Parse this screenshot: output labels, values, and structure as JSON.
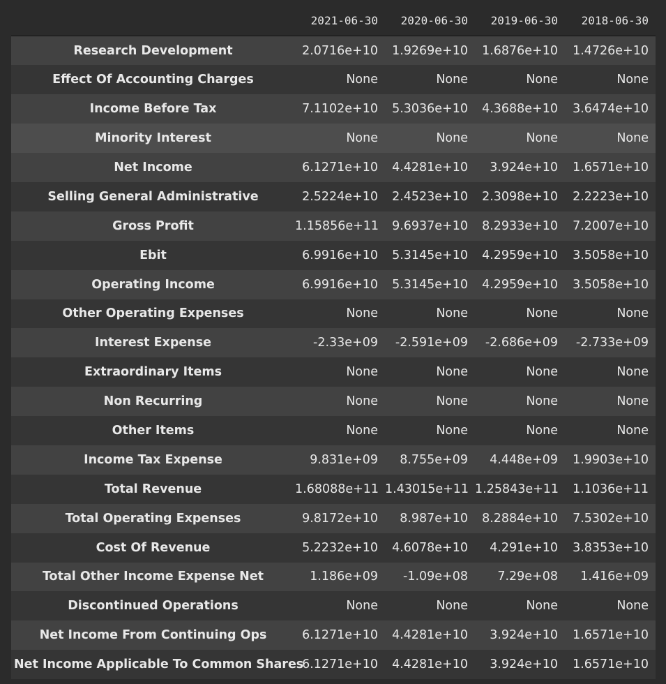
{
  "table": {
    "columns": [
      "2021-06-30",
      "2020-06-30",
      "2019-06-30",
      "2018-06-30"
    ],
    "rows": [
      {
        "label": "Research Development",
        "values": [
          "2.0716e+10",
          "1.9269e+10",
          "1.6876e+10",
          "1.4726e+10"
        ]
      },
      {
        "label": "Effect Of Accounting Charges",
        "values": [
          "None",
          "None",
          "None",
          "None"
        ]
      },
      {
        "label": "Income Before Tax",
        "values": [
          "7.1102e+10",
          "5.3036e+10",
          "4.3688e+10",
          "3.6474e+10"
        ]
      },
      {
        "label": "Minority Interest",
        "values": [
          "None",
          "None",
          "None",
          "None"
        ]
      },
      {
        "label": "Net Income",
        "values": [
          "6.1271e+10",
          "4.4281e+10",
          "3.924e+10",
          "1.6571e+10"
        ]
      },
      {
        "label": "Selling General Administrative",
        "values": [
          "2.5224e+10",
          "2.4523e+10",
          "2.3098e+10",
          "2.2223e+10"
        ]
      },
      {
        "label": "Gross Profit",
        "values": [
          "1.15856e+11",
          "9.6937e+10",
          "8.2933e+10",
          "7.2007e+10"
        ]
      },
      {
        "label": "Ebit",
        "values": [
          "6.9916e+10",
          "5.3145e+10",
          "4.2959e+10",
          "3.5058e+10"
        ]
      },
      {
        "label": "Operating Income",
        "values": [
          "6.9916e+10",
          "5.3145e+10",
          "4.2959e+10",
          "3.5058e+10"
        ]
      },
      {
        "label": "Other Operating Expenses",
        "values": [
          "None",
          "None",
          "None",
          "None"
        ]
      },
      {
        "label": "Interest Expense",
        "values": [
          "-2.33e+09",
          "-2.591e+09",
          "-2.686e+09",
          "-2.733e+09"
        ]
      },
      {
        "label": "Extraordinary Items",
        "values": [
          "None",
          "None",
          "None",
          "None"
        ]
      },
      {
        "label": "Non Recurring",
        "values": [
          "None",
          "None",
          "None",
          "None"
        ]
      },
      {
        "label": "Other Items",
        "values": [
          "None",
          "None",
          "None",
          "None"
        ]
      },
      {
        "label": "Income Tax Expense",
        "values": [
          "9.831e+09",
          "8.755e+09",
          "4.448e+09",
          "1.9903e+10"
        ]
      },
      {
        "label": "Total Revenue",
        "values": [
          "1.68088e+11",
          "1.43015e+11",
          "1.25843e+11",
          "1.1036e+11"
        ]
      },
      {
        "label": "Total Operating Expenses",
        "values": [
          "9.8172e+10",
          "8.987e+10",
          "8.2884e+10",
          "7.5302e+10"
        ]
      },
      {
        "label": "Cost Of Revenue",
        "values": [
          "5.2232e+10",
          "4.6078e+10",
          "4.291e+10",
          "3.8353e+10"
        ]
      },
      {
        "label": "Total Other Income Expense Net",
        "values": [
          "1.186e+09",
          "-1.09e+08",
          "7.29e+08",
          "1.416e+09"
        ]
      },
      {
        "label": "Discontinued Operations",
        "values": [
          "None",
          "None",
          "None",
          "None"
        ]
      },
      {
        "label": "Net Income From Continuing Ops",
        "values": [
          "6.1271e+10",
          "4.4281e+10",
          "3.924e+10",
          "1.6571e+10"
        ]
      },
      {
        "label": "Net Income Applicable To Common Shares",
        "values": [
          "6.1271e+10",
          "4.4281e+10",
          "3.924e+10",
          "1.6571e+10"
        ]
      }
    ]
  }
}
